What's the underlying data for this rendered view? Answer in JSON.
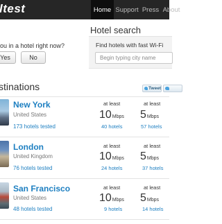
{
  "header": {
    "logo": "ltest",
    "nav": [
      "Home",
      "Support",
      "Press",
      "About"
    ]
  },
  "hotel_question": {
    "text": "ou in a hotel right now?",
    "yes": "Yes",
    "no": "No"
  },
  "hotel_search": {
    "title": "Hotel search",
    "label": "Find hotels with fast Wi-Fi",
    "placeholder": "Begin typing city name"
  },
  "destinations": {
    "title": "stinations",
    "tweet_label": "Tweet",
    "items": [
      {
        "city": "New York",
        "country": "United States",
        "tested": "173 hotels tested",
        "metrics": [
          {
            "label": "at least",
            "value": "10",
            "unit": "Mbps",
            "hotels": "40 hotels"
          },
          {
            "label": "at least",
            "value": "5",
            "unit": "Mbps",
            "hotels": "57 hotels"
          }
        ]
      },
      {
        "city": "London",
        "country": "United Kingdom",
        "tested": "76 hotels tested",
        "metrics": [
          {
            "label": "at least",
            "value": "10",
            "unit": "Mbps",
            "hotels": "24 hotels"
          },
          {
            "label": "at least",
            "value": "5",
            "unit": "Mbps",
            "hotels": "37 hotels"
          }
        ]
      },
      {
        "city": "San Francisco",
        "country": "United States",
        "tested": "48 hotels tested",
        "metrics": [
          {
            "label": "at least",
            "value": "10",
            "unit": "Mbps",
            "hotels": "9 hotels"
          },
          {
            "label": "at least",
            "value": "5",
            "unit": "Mbps",
            "hotels": "14 hotels"
          }
        ]
      }
    ]
  },
  "colors": {
    "topbar": "#262626",
    "link": "#1d7fc1",
    "panel": "#f3f3f3"
  }
}
